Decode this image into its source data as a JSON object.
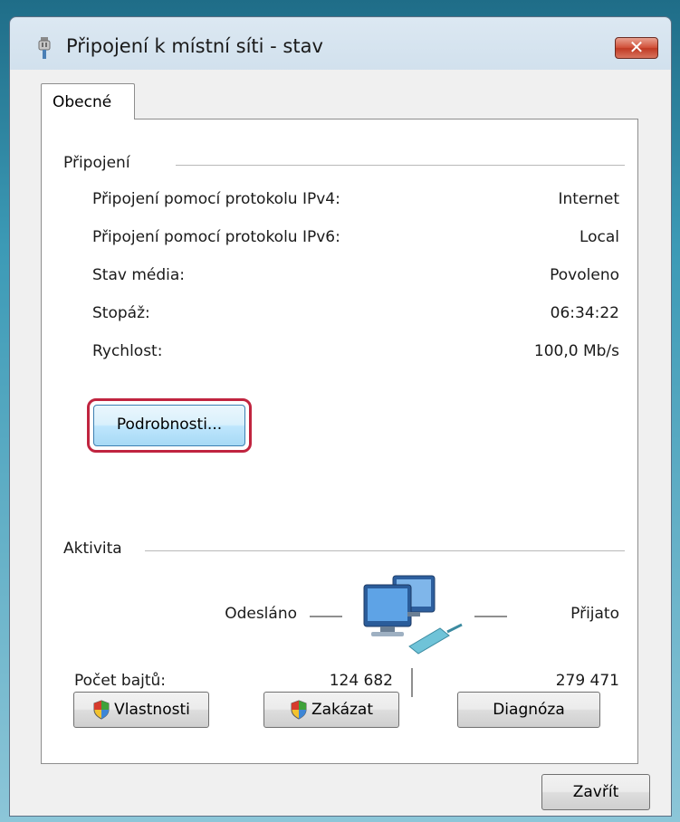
{
  "window": {
    "title": "Připojení k místní síti - stav",
    "close_label": "✕",
    "icon": "network-cable-icon"
  },
  "tabs": [
    {
      "label": "Obecné",
      "selected": true
    }
  ],
  "connection": {
    "heading": "Připojení",
    "rows": [
      {
        "label": "Připojení pomocí protokolu IPv4:",
        "value": "Internet"
      },
      {
        "label": "Připojení pomocí protokolu IPv6:",
        "value": "Local"
      },
      {
        "label": "Stav média:",
        "value": "Povoleno"
      },
      {
        "label": "Stopáž:",
        "value": "06:34:22"
      },
      {
        "label": "Rychlost:",
        "value": "100,0 Mb/s"
      }
    ],
    "details_button": "Podrobnosti..."
  },
  "activity": {
    "heading": "Aktivita",
    "sent_label": "Odesláno",
    "received_label": "Přijato",
    "bytes_label": "Počet bajtů:",
    "bytes_sent": "124 682",
    "bytes_received": "279 471",
    "icon": "network-computers-icon"
  },
  "buttons": {
    "properties": "Vlastnosti",
    "disable": "Zakázat",
    "diagnose": "Diagnóza",
    "close": "Zavřít"
  },
  "colors": {
    "highlight_ring": "#c0243f",
    "close_button": "#c9442e"
  }
}
